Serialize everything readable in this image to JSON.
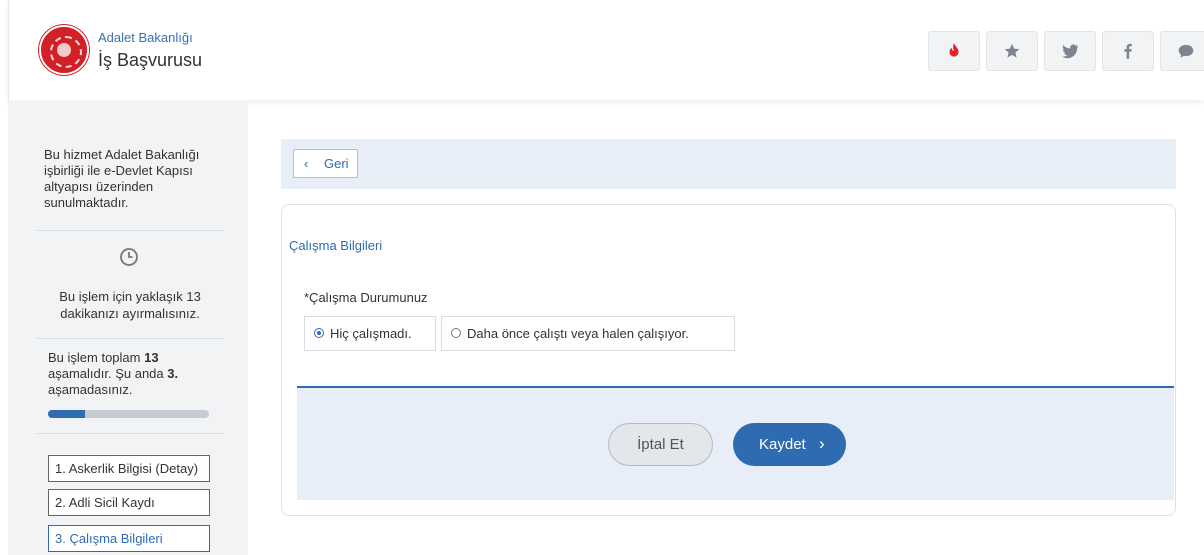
{
  "header": {
    "org_name": "Adalet Bakanlığı",
    "service_title": "İş Başvurusu",
    "icons": [
      "fire-icon",
      "star-icon",
      "twitter-icon",
      "facebook-icon",
      "chat-icon"
    ],
    "fire_color": "#e5222a",
    "icon_color": "#7d8590"
  },
  "sidebar": {
    "info_text": "Bu hizmet Adalet Bakanlığı işbirliği ile e-Devlet Kapısı altyapısı üzerinden sunulmaktadır.",
    "time_text": "Bu işlem için yaklaşık 13 dakikanızı ayırmalısınız.",
    "steps_text_1": "Bu işlem toplam ",
    "total_steps": "13",
    "steps_text_2": " aşamalıdır. Şu anda ",
    "current_step": "3.",
    "steps_text_3": " aşamadasınız.",
    "progress_percent": 23,
    "step_items": [
      "1. Askerlik Bilgisi (Detay)",
      "2. Adli Sicil Kaydı",
      "3. Çalışma Bilgileri"
    ]
  },
  "main": {
    "back_label": "Geri",
    "section_title": "Çalışma Bilgileri",
    "field_label": "*Çalışma Durumunuz",
    "options": [
      {
        "label": "Hiç çalışmadı.",
        "selected": true
      },
      {
        "label": "Daha önce çalıştı veya halen çalışıyor.",
        "selected": false
      }
    ],
    "cancel_label": "İptal Et",
    "save_label": "Kaydet"
  },
  "colors": {
    "accent": "#2e6bb0",
    "brand_red": "#d31f26"
  }
}
